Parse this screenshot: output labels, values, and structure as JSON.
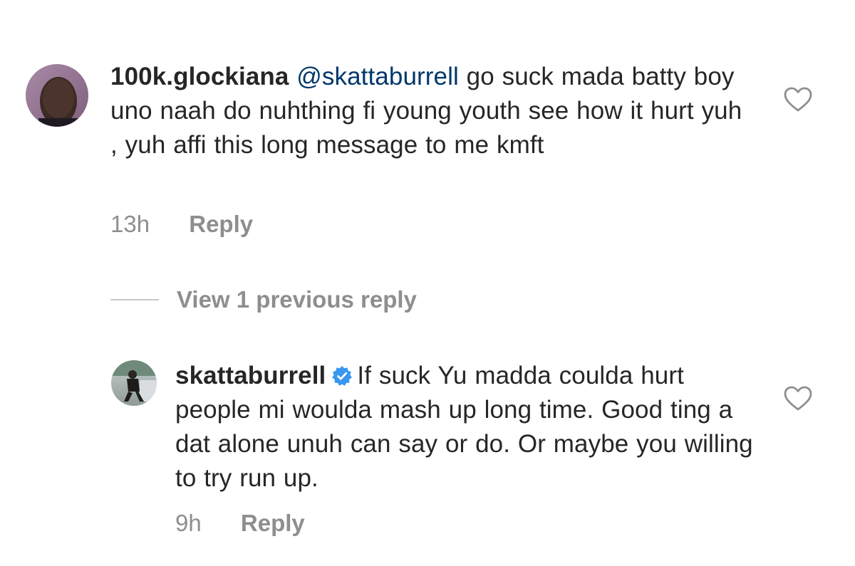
{
  "comments": [
    {
      "username": "100k.glockiana",
      "mention": "@skattaburrell",
      "text": " go suck mada batty boy uno naah do nuhthing fi young youth see how it hurt yuh , yuh affi this long message to me kmft",
      "time": "13h",
      "reply_label": "Reply",
      "avatar_icon": "user-avatar",
      "like_icon": "heart-outline-icon"
    },
    {
      "username": "skattaburrell",
      "verified": true,
      "text": "If suck Yu madda coulda hurt people mi woulda mash up long time. Good ting a dat alone unuh can say or do. Or maybe you willing to try run up.",
      "time": "9h",
      "reply_label": "Reply",
      "avatar_icon": "user-avatar",
      "like_icon": "heart-outline-icon"
    }
  ],
  "view_replies_label": "View 1 previous reply",
  "colors": {
    "text": "#262626",
    "secondary": "#8e8e8e",
    "mention": "#00376b",
    "verified": "#3897f0"
  }
}
